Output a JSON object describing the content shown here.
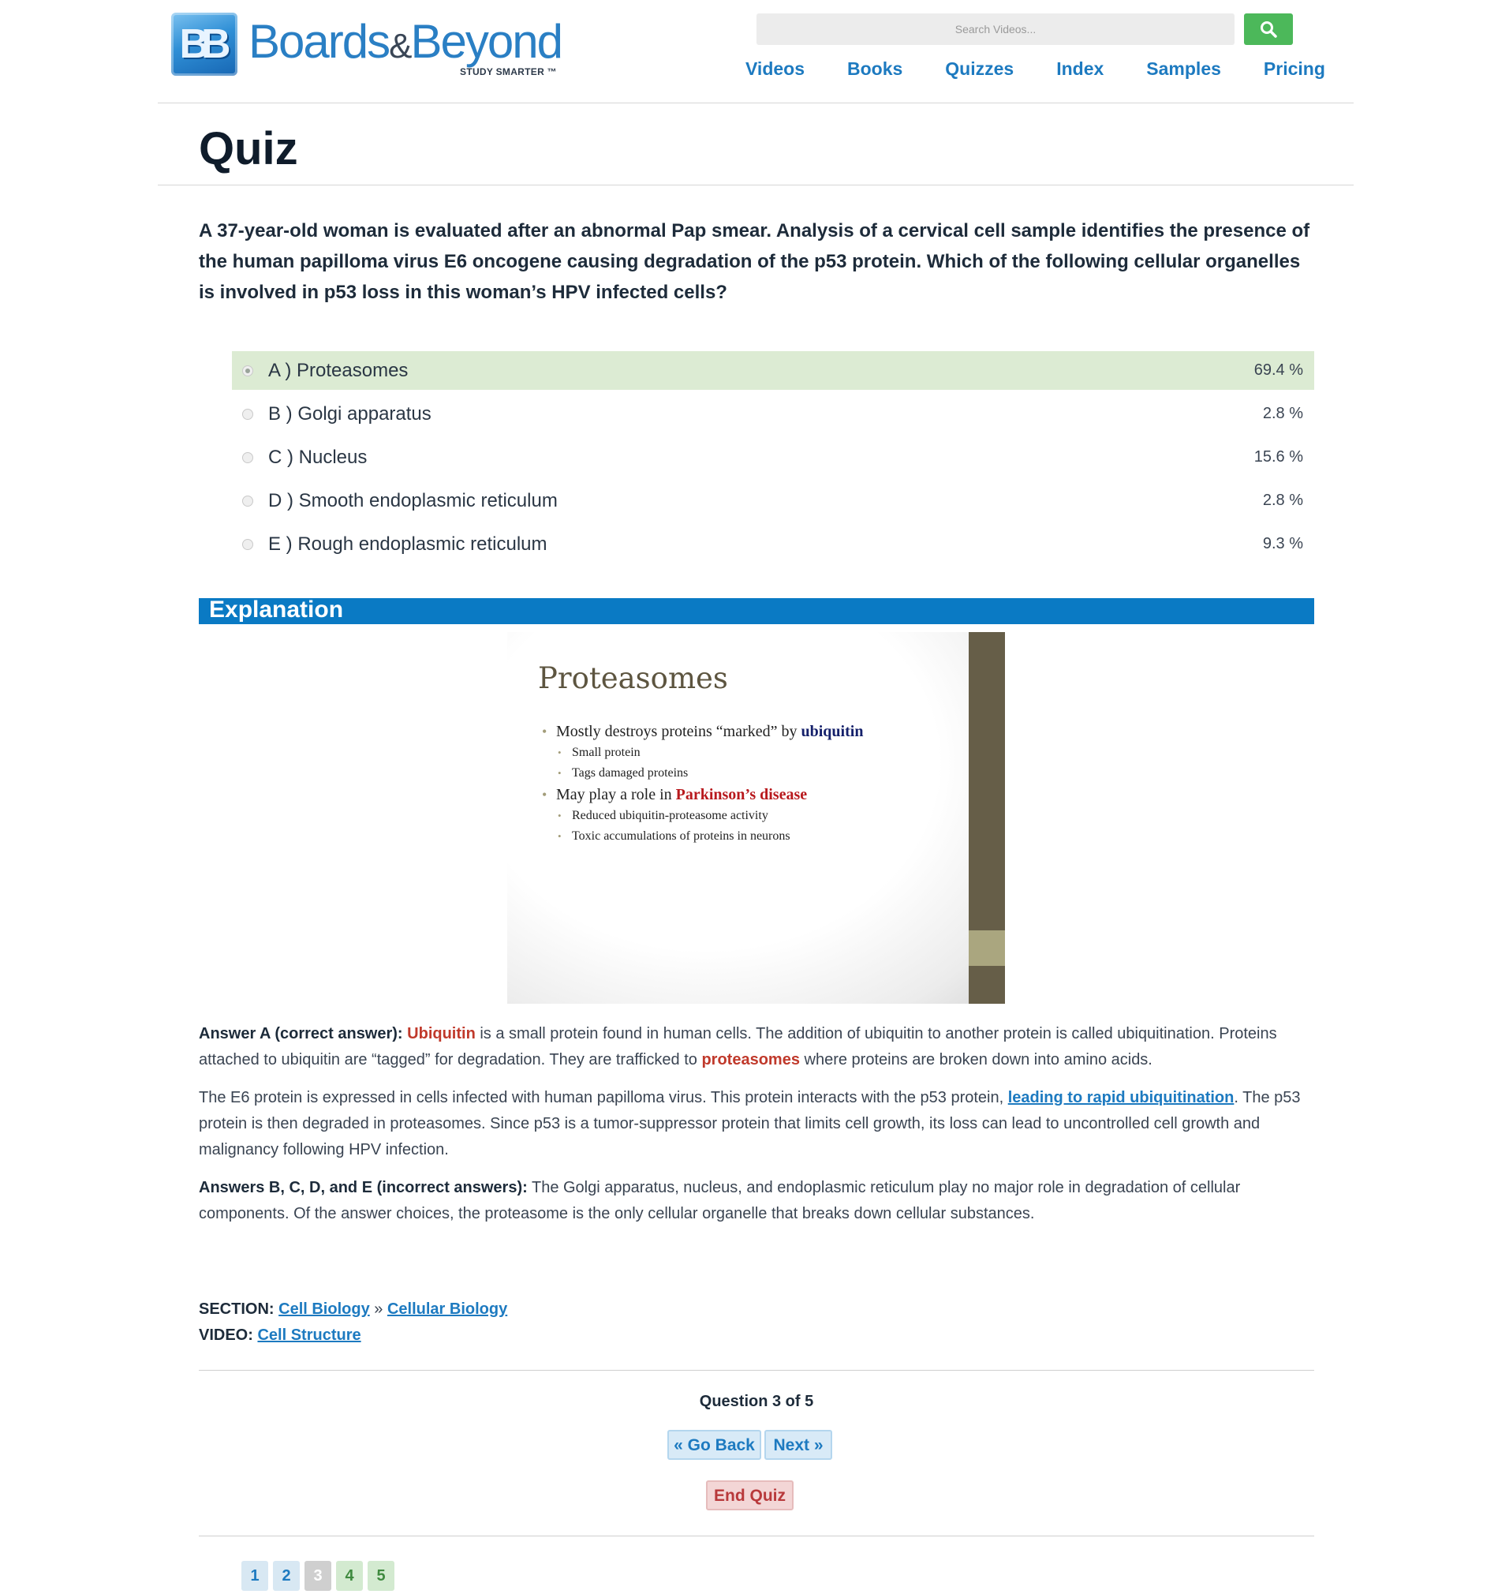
{
  "header": {
    "logo_word_left": "Boards",
    "logo_amp": "&",
    "logo_word_right": "Beyond",
    "logo_tagline": "STUDY SMARTER ™",
    "logo_mark": "BB",
    "search_placeholder": "Search Videos...",
    "search_icon": "search-icon",
    "nav": [
      "Videos",
      "Books",
      "Quizzes",
      "Index",
      "Samples",
      "Pricing"
    ]
  },
  "page_title": "Quiz",
  "question": "A 37-year-old woman is evaluated after an abnormal Pap smear. Analysis of a cervical cell sample identifies the presence of the human papilloma virus E6 oncogene causing degradation of the p53 protein. Which of the following cellular organelles is involved in p53 loss in this woman’s HPV infected cells?",
  "answers": [
    {
      "label": "A ) Proteasomes",
      "percent": "69.4 %",
      "correct": true
    },
    {
      "label": "B ) Golgi apparatus",
      "percent": "2.8 %",
      "correct": false
    },
    {
      "label": "C ) Nucleus",
      "percent": "15.6 %",
      "correct": false
    },
    {
      "label": "D ) Smooth endoplasmic reticulum",
      "percent": "2.8 %",
      "correct": false
    },
    {
      "label": "E ) Rough endoplasmic reticulum",
      "percent": "9.3 %",
      "correct": false
    }
  ],
  "explanation": {
    "heading": "Explanation",
    "slide": {
      "title": "Proteasomes",
      "bullet1_pre": "Mostly destroys proteins “marked” by ",
      "bullet1_hl": "ubiquitin",
      "sub1": "Small protein",
      "sub2": "Tags damaged proteins",
      "bullet2_pre": "May play a role in ",
      "bullet2_hl": "Parkinson’s disease",
      "sub3": "Reduced ubiquitin-proteasome activity",
      "sub4": "Toxic accumulations of proteins in neurons"
    },
    "p1_bold": "Answer A (correct answer):",
    "p1_red1": "Ubiquitin",
    "p1_text1": " is a small protein found in human cells. The addition of ubiquitin to another protein is called ubiquitination. Proteins attached to ubiquitin are “tagged” for degradation. They are trafficked to ",
    "p1_red2": "proteasomes",
    "p1_text2": " where proteins are broken down into amino acids.",
    "p2_text1": "The E6 protein is expressed in cells infected with human papilloma virus. This protein interacts with the p53 protein, ",
    "p2_link": "leading to rapid ubiquitination",
    "p2_text2": ". The p53 protein is then degraded in proteasomes.  Since p53 is a tumor-suppressor protein that limits cell growth, its loss can lead to uncontrolled cell growth and malignancy following HPV infection.",
    "p3_bold": "Answers B, C, D, and E (incorrect answers):",
    "p3_text": " The Golgi apparatus, nucleus, and endoplasmic reticulum play no major role in degradation of cellular components. Of the answer choices, the proteasome is the only cellular organelle that breaks down cellular substances."
  },
  "meta": {
    "section_label": "SECTION:",
    "section_link1": "Cell Biology",
    "separator": "»",
    "section_link2": "Cellular Biology",
    "video_label": "VIDEO:",
    "video_link": "Cell Structure"
  },
  "footer": {
    "question_count": "Question 3 of 5",
    "go_back": "« Go Back",
    "next": "Next »",
    "end_quiz": "End Quiz",
    "pages": [
      "1",
      "2",
      "3",
      "4",
      "5"
    ]
  }
}
